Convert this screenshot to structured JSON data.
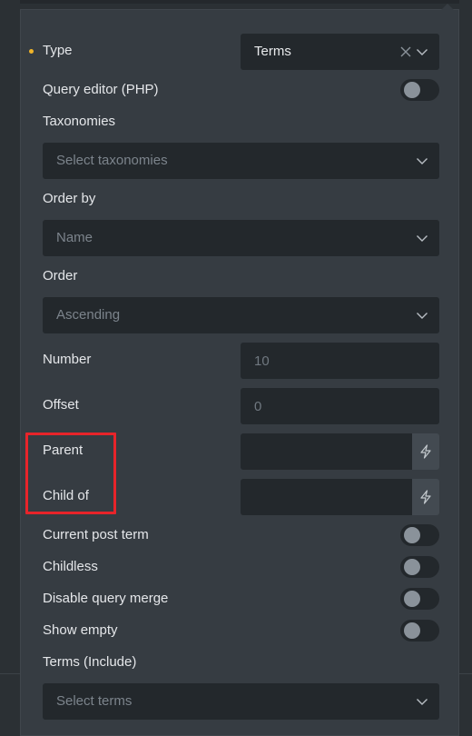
{
  "type": {
    "label": "Type",
    "value": "Terms"
  },
  "query_editor": {
    "label": "Query editor (PHP)"
  },
  "taxonomies": {
    "label": "Taxonomies",
    "placeholder": "Select taxonomies"
  },
  "order_by": {
    "label": "Order by",
    "placeholder": "Name"
  },
  "order": {
    "label": "Order",
    "placeholder": "Ascending"
  },
  "number": {
    "label": "Number",
    "placeholder": "10"
  },
  "offset": {
    "label": "Offset",
    "placeholder": "0"
  },
  "parent": {
    "label": "Parent"
  },
  "child_of": {
    "label": "Child of"
  },
  "current_post_term": {
    "label": "Current post term"
  },
  "childless": {
    "label": "Childless"
  },
  "disable_query_merge": {
    "label": "Disable query merge"
  },
  "show_empty": {
    "label": "Show empty"
  },
  "terms_include": {
    "label": "Terms (Include)",
    "placeholder": "Select terms"
  },
  "colors": {
    "panel_bg": "#363c42",
    "field_bg": "#23282c",
    "required_dot": "#f0b429",
    "highlight_border": "#e8242a"
  },
  "icons": [
    "clear-icon",
    "chevron-down-icon",
    "lightning-icon"
  ]
}
